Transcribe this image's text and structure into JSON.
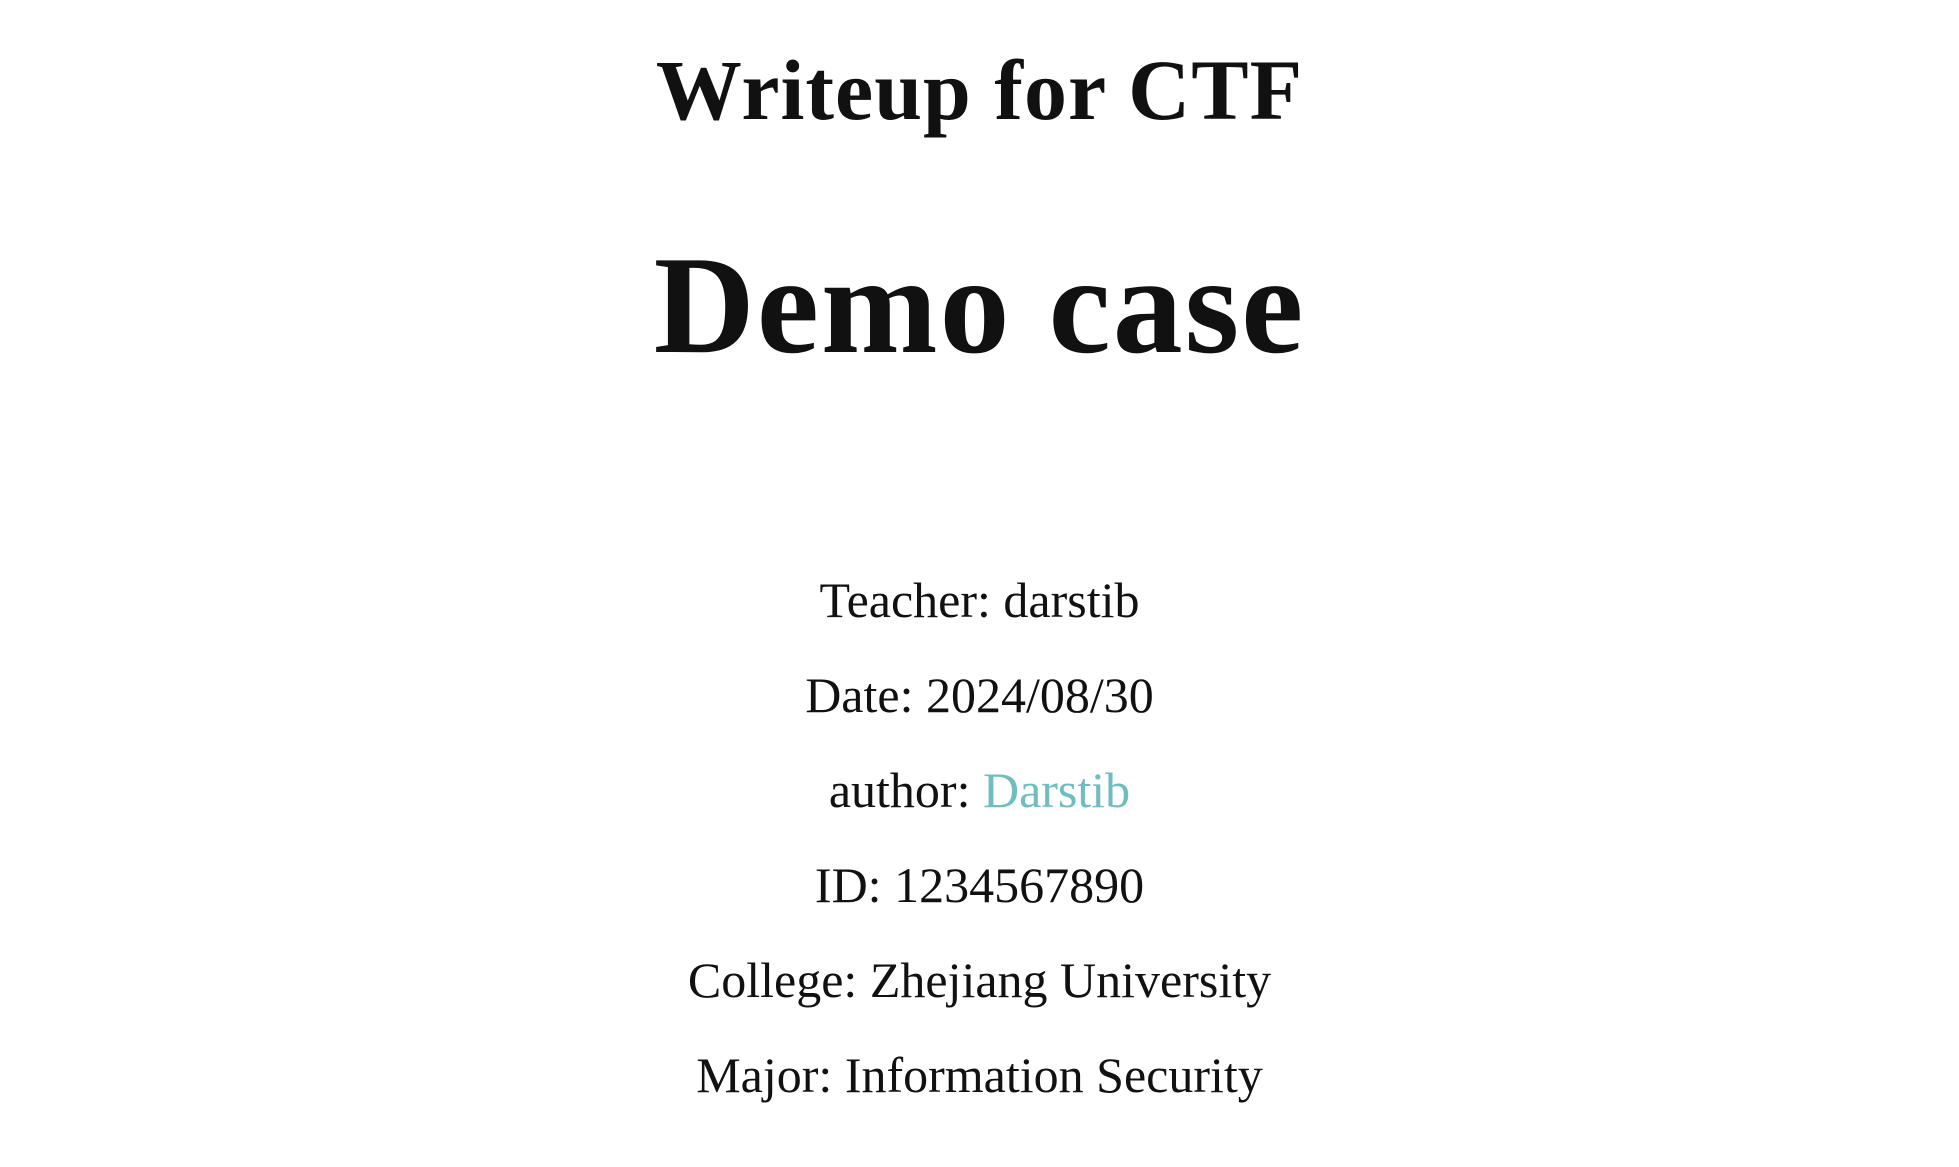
{
  "header": {
    "subtitle": "Writeup for CTF",
    "title": "Demo case"
  },
  "info": {
    "teacher_label": "Teacher: ",
    "teacher_value": "darstib",
    "date_label": "Date: ",
    "date_value": "2024/08/30",
    "author_label": "author: ",
    "author_value": "Darstib",
    "id_label": "ID: ",
    "id_value": "1234567890",
    "college_label": "College: ",
    "college_value": "Zhejiang University",
    "major_label": "Major: ",
    "major_value": "Information Security"
  },
  "colors": {
    "link": "#6fbdbf",
    "text": "#111111"
  }
}
